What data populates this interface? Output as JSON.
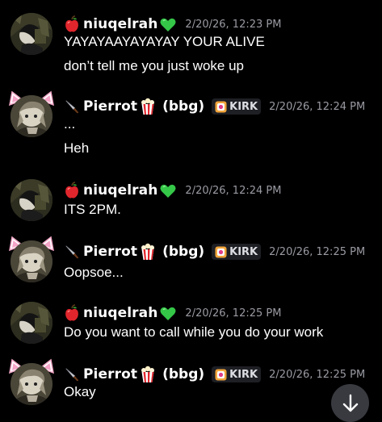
{
  "colors": {
    "background": "#000000",
    "username": "#ffffff",
    "timestamp": "#9a9ba3",
    "tag_bg": "#1e1f24",
    "scroll_button_bg": "#383a40"
  },
  "users": {
    "niuq": {
      "name": "niuqelrah",
      "role_icon": "apple-icon",
      "name_icon": "green-heart-icon"
    },
    "pierrot": {
      "name": "Pierrot",
      "role_icon": "knife-icon",
      "name_icon": "popcorn-icon",
      "pronoun": "(bbg)",
      "tag": "KIRK",
      "tag_icon": "tag-badge-icon"
    }
  },
  "messages": [
    {
      "author": "niuqelrah",
      "timestamp": "2/20/26, 12:23 PM",
      "lines": [
        "YAYAYAAYAYAYAY YOUR ALIVE",
        "don’t tell me you just woke up"
      ]
    },
    {
      "author": "Pierrot",
      "timestamp": "2/20/26, 12:24 PM",
      "lines": [
        "...",
        "Heh"
      ]
    },
    {
      "author": "niuqelrah",
      "timestamp": "2/20/26, 12:24 PM",
      "lines": [
        "ITS 2PM."
      ]
    },
    {
      "author": "Pierrot",
      "timestamp": "2/20/26, 12:25 PM",
      "lines": [
        "Oopsoe..."
      ]
    },
    {
      "author": "niuqelrah",
      "timestamp": "2/20/26, 12:25 PM",
      "lines": [
        "Do you want to call while you do your work"
      ]
    },
    {
      "author": "Pierrot",
      "timestamp": "2/20/26, 12:25 PM",
      "lines": [
        "Okay"
      ]
    }
  ],
  "scroll_button": {
    "icon": "arrow-down-icon"
  }
}
